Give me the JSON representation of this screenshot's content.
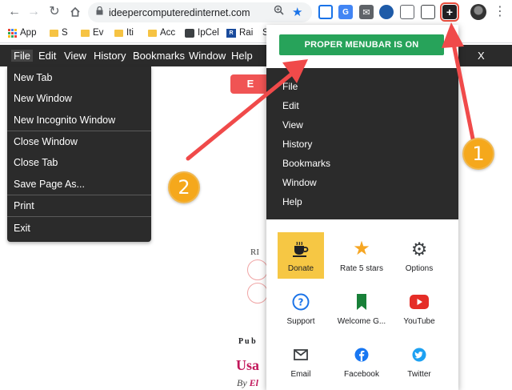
{
  "browser": {
    "url": "ideepercomputeredinternet.com",
    "nav": {
      "back": "back-icon",
      "forward": "forward-icon",
      "reload": "reload-icon",
      "home": "home-icon"
    },
    "extensions": [
      "screenshot-icon",
      "translate-icon",
      "mail-icon",
      "extension-icon",
      "reader-icon",
      "pip-icon",
      "proper-menubar-icon"
    ]
  },
  "bookmarks": [
    {
      "label": "App",
      "icon": "apps-icon"
    },
    {
      "label": "S",
      "icon": "folder-icon"
    },
    {
      "label": "Ev",
      "icon": "folder-icon"
    },
    {
      "label": "Iti",
      "icon": "folder-icon"
    },
    {
      "label": "Acc",
      "icon": "folder-icon"
    },
    {
      "label": "IpCel",
      "icon": "ipcel-icon"
    },
    {
      "label": "Rai",
      "icon": "rai-icon"
    },
    {
      "label": "S",
      "icon": "bookmark-icon"
    }
  ],
  "menubar": {
    "items": [
      "File",
      "Edit",
      "View",
      "History",
      "Bookmarks",
      "Window",
      "Help"
    ],
    "close": "X"
  },
  "file_menu": {
    "group1": [
      "New Tab",
      "New Window",
      "New Incognito Window"
    ],
    "group2": [
      "Close Window",
      "Close Tab",
      "Save Page As..."
    ],
    "group3": [
      "Print"
    ],
    "group4": [
      "Exit"
    ]
  },
  "page": {
    "button": "E",
    "label_r": "RI",
    "pub": "P u b",
    "title": "Usa",
    "byline": "By",
    "author": "El"
  },
  "popup": {
    "status": "PROPER MENUBAR IS ON",
    "menu": [
      "File",
      "Edit",
      "View",
      "History",
      "Bookmarks",
      "Window",
      "Help"
    ],
    "tiles": [
      {
        "label": "Donate",
        "icon": "coffee-icon",
        "color": "#202124"
      },
      {
        "label": "Rate 5 stars",
        "icon": "star-icon",
        "color": "#f6a623"
      },
      {
        "label": "Options",
        "icon": "gear-icon",
        "color": "#3c4043"
      },
      {
        "label": "Support",
        "icon": "help-icon",
        "color": "#1a73e8"
      },
      {
        "label": "Welcome G...",
        "icon": "bookmark-icon",
        "color": "#188038"
      },
      {
        "label": "YouTube",
        "icon": "youtube-icon",
        "color": "#e52d27"
      },
      {
        "label": "Email",
        "icon": "email-icon",
        "color": "#3c4043"
      },
      {
        "label": "Facebook",
        "icon": "facebook-icon",
        "color": "#1877f2"
      },
      {
        "label": "Twitter",
        "icon": "twitter-icon",
        "color": "#1da1f2"
      }
    ]
  },
  "annotations": {
    "badge1": "1",
    "badge2": "2",
    "arrow_color": "#f04a4a",
    "badge_color": "#f5a81c"
  }
}
